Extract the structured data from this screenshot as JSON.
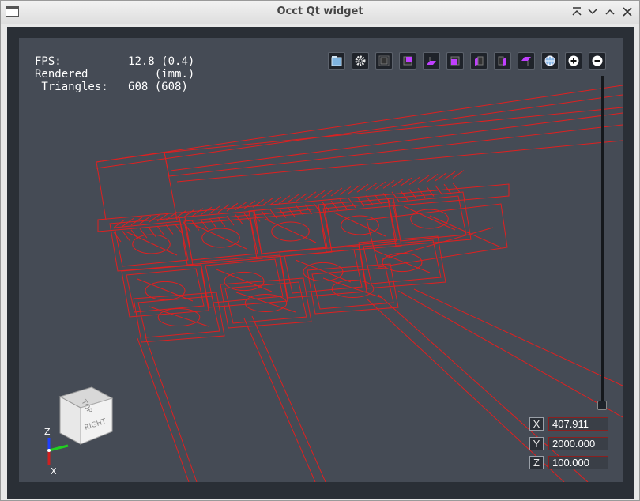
{
  "window": {
    "title": "Occt Qt widget"
  },
  "stats": {
    "fps_label": "FPS:",
    "fps_value": "12.8 (0.4)",
    "rendered_label": "Rendered",
    "rendered_value": "(imm.)",
    "triangles_label": " Triangles:",
    "triangles_value": "608 (608)"
  },
  "toolbar": {
    "buttons": [
      {
        "name": "open-file-button",
        "icon": "file-icon"
      },
      {
        "name": "settings-button",
        "icon": "gear-icon"
      },
      {
        "name": "view-fit-button",
        "icon": "frame-icon"
      },
      {
        "name": "view-front-button",
        "icon": "cube-front-icon"
      },
      {
        "name": "view-bottom-button",
        "icon": "cube-bottom-icon"
      },
      {
        "name": "view-back-button",
        "icon": "cube-back-icon"
      },
      {
        "name": "view-left-button",
        "icon": "cube-left-icon"
      },
      {
        "name": "view-right-button",
        "icon": "cube-right-icon"
      },
      {
        "name": "view-top-button",
        "icon": "cube-top-icon"
      },
      {
        "name": "view-iso-button",
        "icon": "globe-icon"
      },
      {
        "name": "zoom-in-button",
        "icon": "plus-icon"
      },
      {
        "name": "zoom-out-button",
        "icon": "minus-icon"
      }
    ],
    "accent": "#c040ff"
  },
  "viewcube": {
    "top_label": "TOP",
    "right_label": "RIGHT"
  },
  "axes": {
    "z_label": "Z",
    "x_label": "X"
  },
  "coords": {
    "x_label": "X",
    "x_value": "407.911",
    "y_label": "Y",
    "y_value": "2000.000",
    "z_label": "Z",
    "z_value": "100.000"
  },
  "colors": {
    "wireframe": "#e02020",
    "viewport_bg": "#454b55"
  }
}
